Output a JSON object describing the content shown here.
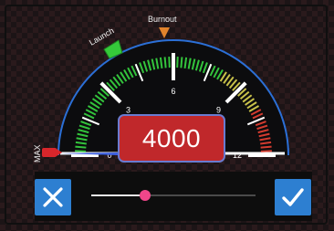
{
  "gauge": {
    "max": 12,
    "tick_labels": [
      "0",
      "3",
      "6",
      "9",
      "12"
    ],
    "markers": {
      "launch_label": "Launch",
      "burnout_label": "Burnout",
      "max_label": "MAX"
    },
    "value": "4000",
    "colors": {
      "arc_outline": "#2b6fd6",
      "green_zone": "#33c43c",
      "yellow_zone": "#c9c24a",
      "red_zone": "#d33b2f",
      "value_box": "#c0282b",
      "launch_marker": "#35c93a",
      "burnout_marker": "#e0832c",
      "max_marker": "#d8262b"
    }
  },
  "controls": {
    "cancel_icon": "close-icon",
    "confirm_icon": "check-icon",
    "slider_level": 0.33,
    "slider_color": "#f0468a",
    "button_color": "#2d7fd1"
  }
}
